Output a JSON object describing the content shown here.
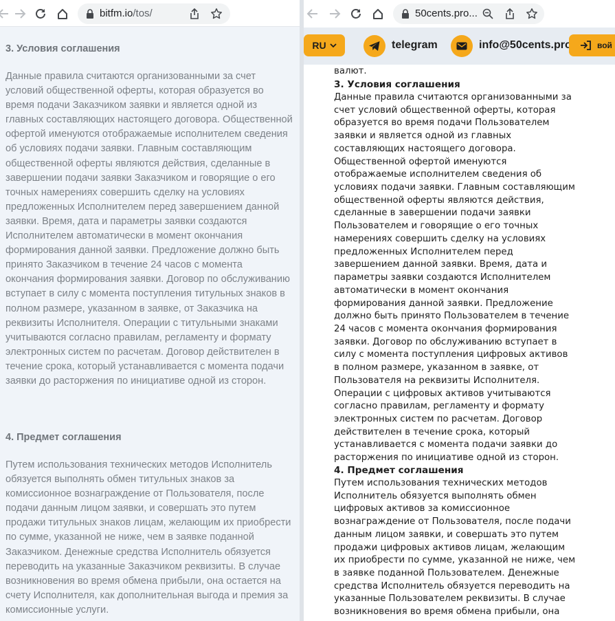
{
  "left_browser": {
    "url_host": "bitfm.io",
    "url_path": "/tos/",
    "content": {
      "section3_title": "3. Условия соглашения",
      "section3_body": "Данные правила считаются организованными за счет условий общественной оферты, которая образуется во время подачи Заказчиком заявки и является одной из главных составляющих настоящего договора. Общественной офертой именуются отображаемые исполнителем сведения об условиях подачи заявки. Главным составляющим общественной оферты являются действия, сделанные в завершении подачи заявки Заказчиком и говорящие о его точных намерениях совершить сделку на условиях предложенных Исполнителем перед завершением данной заявки. Время, дата и параметры заявки создаются Исполнителем автоматически в момент окончания формирования данной заявки. Предложение должно быть принято Заказчиком в течение 24 часов с момента окончания формирования заявки. Договор по обслуживанию вступает в силу с момента поступления титульных знаков в полном размере, указанном в заявке, от Заказчика на реквизиты Исполнителя. Операции с титульными знаками учитываются согласно правилам, регламенту и формату электронных систем по расчетам. Договор действителен в течение срока, который устанавливается с момента подачи заявки до расторжения по инициативе одной из сторон.",
      "section4_title": "4. Предмет соглашения",
      "section4_body": "Путем использования технических методов Исполнитель обязуется выполнять обмен титульных знаков за комиссионное вознаграждение от Пользователя, после подачи данным лицом заявки, и совершать это путем продажи титульных знаков лицам, желающим их приобрести по сумме, указанной не ниже, чем в заявке поданной Заказчиком. Денежные средства Исполнитель обязуется переводить на указанные Заказчиком реквизиты. В случае возникновения во время обмена прибыли, она остается на счету Исполнителя, как дополнительная выгода и премия за комиссионные услуги."
    }
  },
  "right_browser": {
    "url_text": "50cents.pro...",
    "header": {
      "lang_label": "RU",
      "telegram_label": "telegram",
      "email_label": "info@50cents.pro",
      "login_label": "вой"
    },
    "content": {
      "prev_line": "валют.",
      "section3_title": "3. Условия соглашения",
      "section3_body": "Данные правила считаются организованными за\nсчет условий общественной оферты, которая\nобразуется во время подачи Пользователем\nзаявки и является одной из главных\nсоставляющих настоящего договора.\nОбщественной офертой именуются\nотображаемые исполнителем сведения об\nусловиях подачи заявки. Главным составляющим\nобщественной оферты являются действия,\nсделанные в завершении подачи заявки\nПользователем и говорящие о его точных\nнамерениях совершить сделку на условиях\nпредложенных Исполнителем перед\nзавершением данной заявки. Время, дата и\nпараметры заявки создаются Исполнителем\nавтоматически в момент окончания\nформирования данной заявки. Предложение\nдолжно быть принято Пользователем в течение\n24 часов с момента окончания формирования\nзаявки. Договор по обслуживанию вступает в\nсилу с момента поступления цифровых активов\nв полном размере, указанном в заявке, от\nПользователя на реквизиты Исполнителя.\nОперации с цифровых активов учитываются\nсогласно правилам, регламенту и формату\nэлектронных систем по расчетам. Договор\nдействителен в течение срока, который\nустанавливается с момента подачи заявки до\nрасторжения по инициативе одной из сторон.",
      "section4_title": "4. Предмет соглашения",
      "section4_body": "Путем использования технических методов\nИсполнитель обязуется выполнять обмен\nцифровых активов за комиссионное\nвознаграждение от Пользователя, после подачи\nданным лицом заявки, и совершать это путем\nпродажи цифровых активов лицам, желающим\nих приобрести по сумме, указанной не ниже, чем\nв заявке поданной Пользователем. Денежные\nсредства Исполнитель обязуется переводить на\nуказанные Пользователем реквизиты. В случае\nвозникновения во время обмена прибыли, она"
    }
  },
  "colors": {
    "accent": "#f5a81b",
    "left_bg": "#f0f4f9",
    "left_text": "#7d8288",
    "right_text": "#1f1f1f"
  },
  "icons": [
    "back-arrow-icon",
    "forward-arrow-icon",
    "reload-icon",
    "home-icon",
    "lock-icon",
    "share-icon",
    "star-icon",
    "zoom-icon",
    "chevron-down-icon",
    "telegram-icon",
    "mail-icon",
    "login-icon"
  ]
}
